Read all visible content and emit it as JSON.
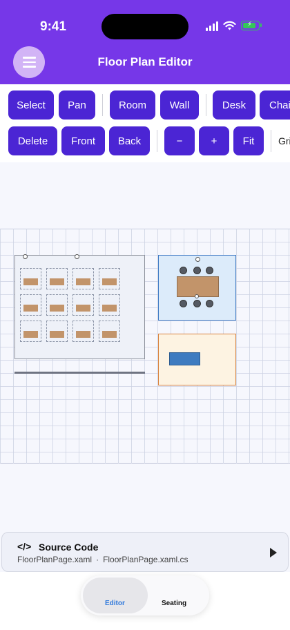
{
  "status": {
    "time": "9:41"
  },
  "header": {
    "title": "Floor Plan Editor"
  },
  "toolbar": {
    "row1": [
      "Select",
      "Pan",
      "Room",
      "Wall",
      "Desk",
      "Chai"
    ],
    "row2": [
      "Delete",
      "Front",
      "Back",
      "−",
      "+",
      "Fit"
    ],
    "grid_label": "Gri"
  },
  "floorplan": {
    "open_office_desks": [
      [
        "",
        "",
        "",
        ""
      ],
      [
        "",
        "",
        "",
        ""
      ],
      [
        "",
        "",
        "",
        ""
      ]
    ],
    "meeting_table_label": "",
    "sofa_label": "",
    "sofa_tag": ""
  },
  "source": {
    "icon": "</>",
    "title": "Source Code",
    "file1": "FloorPlanPage.xaml",
    "separator": "·",
    "file2": "FloorPlanPage.xaml.cs"
  },
  "tabs": {
    "editor": "Editor",
    "seating": "Seating"
  },
  "colors": {
    "accent": "#7637e8",
    "button": "#4b25d4",
    "active_tab": "#2e78db"
  }
}
